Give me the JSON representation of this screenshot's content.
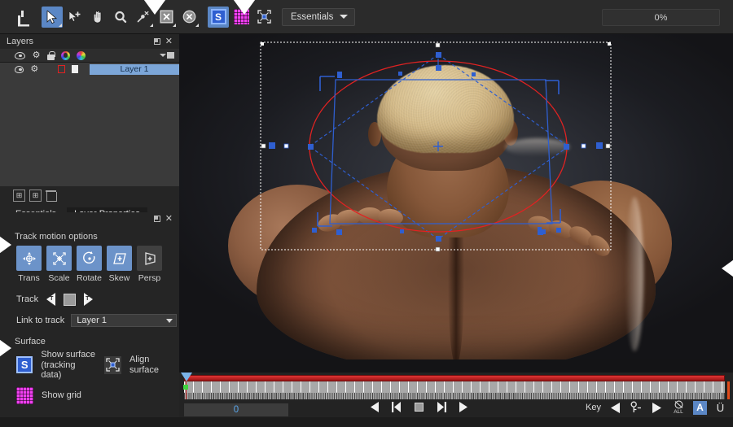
{
  "app": {
    "workspace_label": "Essentials",
    "progress_label": "0%"
  },
  "toolbar": {
    "tools": [
      {
        "name": "import-icon",
        "label": "Import",
        "icon": "download-icon",
        "selected": false
      },
      {
        "name": "select-tool",
        "label": "Select",
        "icon": "arrow-cursor-icon",
        "selected": true
      },
      {
        "name": "add-point-tool",
        "label": "Add Point",
        "icon": "arrow-plus-icon",
        "selected": false
      },
      {
        "name": "pan-tool",
        "label": "Pan",
        "icon": "hand-icon",
        "selected": false
      },
      {
        "name": "zoom-tool",
        "label": "Zoom",
        "icon": "magnifier-icon",
        "selected": false
      },
      {
        "name": "pin-tool",
        "label": "Pin",
        "icon": "pin-x-icon",
        "selected": false
      },
      {
        "name": "delete-x-tool",
        "label": "Delete X",
        "icon": "x-square-icon",
        "selected": false
      },
      {
        "name": "delete-x-round-tool",
        "label": "Delete X Round",
        "icon": "x-circle-icon",
        "selected": false
      },
      {
        "name": "show-surface-tool",
        "label": "Show Surface",
        "icon": "s-badge-icon",
        "selected": true
      },
      {
        "name": "show-grid-tool",
        "label": "Show Grid",
        "icon": "grid-icon",
        "selected": false
      },
      {
        "name": "align-surface-tool",
        "label": "Align Surface",
        "icon": "align-icon",
        "selected": false
      }
    ]
  },
  "layers_panel": {
    "title": "Layers",
    "header_icons": [
      "eye-icon",
      "gear-icon",
      "lock-icon",
      "color-wheel-outline-icon",
      "color-wheel-filled-icon"
    ],
    "rows": [
      {
        "name": "Layer 1",
        "visible": true,
        "swatch_outline": "#e02222",
        "swatch_fill": "#f0f0f0"
      }
    ],
    "footer_buttons": [
      "new-folder-icon",
      "duplicate-icon",
      "delete-icon"
    ]
  },
  "tabs": [
    {
      "label": "Essentials",
      "active": false
    },
    {
      "label": "Layer Properties",
      "active": true
    }
  ],
  "track_motion": {
    "section_label": "Track motion options",
    "options": [
      {
        "label": "Trans",
        "icon": "move-icon",
        "enabled": true
      },
      {
        "label": "Scale",
        "icon": "scale-icon",
        "enabled": true
      },
      {
        "label": "Rotate",
        "icon": "rotate-icon",
        "enabled": true
      },
      {
        "label": "Skew",
        "icon": "skew-icon",
        "enabled": true
      },
      {
        "label": "Persp",
        "icon": "perspective-icon",
        "enabled": false
      }
    ]
  },
  "track_controls": {
    "label": "Track",
    "back_button": "track-backward",
    "stop_button": "track-stop",
    "forward_button": "track-forward",
    "link_label": "Link to track",
    "link_value": "Layer 1"
  },
  "surface": {
    "section_label": "Surface",
    "show_surface_label_line1": "Show surface",
    "show_surface_label_line2": "(tracking data)",
    "align_surface_label": "Align surface",
    "show_grid_label": "Show grid"
  },
  "timeline": {
    "frame_value": "0",
    "key_label": "Key",
    "transport": [
      "prev-frame",
      "step-back",
      "stop",
      "step-forward",
      "play"
    ],
    "key_controls": [
      "prev-key",
      "delete-key",
      "next-key",
      "delete-all-keys",
      "auto-key",
      "u-key"
    ],
    "auto_key_label": "A",
    "u_key_label": "Ü",
    "all_label": "ALL"
  },
  "colors": {
    "accent_blue": "#5b87c5",
    "track_red": "#e02222",
    "magenta": "#f03ff0",
    "surface_blue": "#2f5fd0",
    "panel_bg": "#252525",
    "toolbar_bg": "#2b2b2b",
    "canvas_bg": "#141416"
  }
}
